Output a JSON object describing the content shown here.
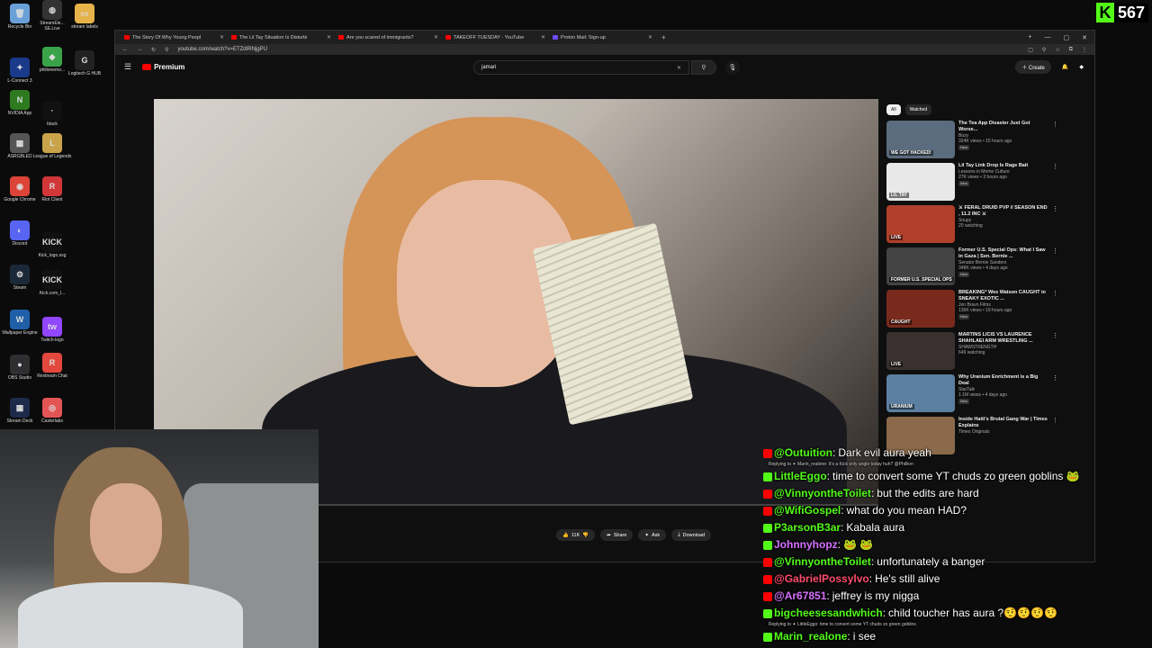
{
  "counter": {
    "value": "567"
  },
  "desktop_icons": [
    {
      "label": "Recycle Bin",
      "color": "#6aa0d8",
      "glyph": "🗑"
    },
    {
      "label": "StreamEle... SE.Live",
      "color": "#333",
      "glyph": "◍"
    },
    {
      "label": "stream labels",
      "color": "#e6b24a",
      "glyph": "▭"
    },
    {
      "label": "L-Connect 3",
      "color": "#1a3a8a",
      "glyph": "✦"
    },
    {
      "label": "philionemo...",
      "color": "#3aa34a",
      "glyph": "◆"
    },
    {
      "label": "Logitech G HUB",
      "color": "#222",
      "glyph": "G"
    },
    {
      "label": "NVIDIA App",
      "color": "#2d7a1f",
      "glyph": "N"
    },
    {
      "label": "black",
      "color": "#111",
      "glyph": "·"
    },
    {
      "label": "ASRGBLED",
      "color": "#555",
      "glyph": "▦"
    },
    {
      "label": "League of Legends",
      "color": "#c9a34a",
      "glyph": "L"
    },
    {
      "label": "Google Chrome",
      "color": "#db4437",
      "glyph": "◉"
    },
    {
      "label": "Riot Client",
      "color": "#d13639",
      "glyph": "R"
    },
    {
      "label": "Discord",
      "color": "#5865f2",
      "glyph": "◐"
    },
    {
      "label": "Kick_logo.svg",
      "color": "#111",
      "glyph": "KICK"
    },
    {
      "label": "Steam",
      "color": "#1b2838",
      "glyph": "⚙"
    },
    {
      "label": "Kick.com_l...",
      "color": "#111",
      "glyph": "KICK"
    },
    {
      "label": "Wallpaper Engine",
      "color": "#1f5fa8",
      "glyph": "W"
    },
    {
      "label": "Twitch-logo",
      "color": "#9146ff",
      "glyph": "tw"
    },
    {
      "label": "OBS Studio",
      "color": "#302e31",
      "glyph": "●"
    },
    {
      "label": "Restream Chat",
      "color": "#e2483d",
      "glyph": "R"
    },
    {
      "label": "Stream Deck",
      "color": "#1e2a4a",
      "glyph": "▦"
    },
    {
      "label": "Casterlabs",
      "color": "#e35555",
      "glyph": "◎"
    }
  ],
  "browser": {
    "tabs": [
      {
        "title": "The Story Of Why Young Peopl",
        "fav": "#ff0000"
      },
      {
        "title": "The Lil Tay Situation Is Disturbi",
        "fav": "#ff0000"
      },
      {
        "title": "Are you scared of immigrants?",
        "fav": "#ff0000"
      },
      {
        "title": "TAKEOFF TUESDAY - YouTube",
        "fav": "#ff0000"
      },
      {
        "title": "Proton Mail: Sign-up",
        "fav": "#6d4aff"
      }
    ],
    "url": "youtube.com/watch?v=ETZdIRNjgPU"
  },
  "youtube": {
    "logo": "Premium",
    "search_value": "jamari",
    "create_label": "Create",
    "actions": {
      "like": "11K",
      "share": "Share",
      "ask": "Ask",
      "download": "Download"
    },
    "chips": [
      "All",
      "Watched"
    ],
    "recommendations": [
      {
        "title": "The Tea App Disaster Just Got Worse...",
        "channel": "Bozy",
        "meta": "324K views • 15 hours ago",
        "badge": "New",
        "thumb": "#5a6c7d",
        "thumb_text": "WE GOT HACKED!"
      },
      {
        "title": "Lil Tay Link Drop Is Rage Bait",
        "channel": "Lessons in Meme Culture",
        "meta": "27K views • 3 hours ago",
        "badge": "New",
        "thumb": "#e8e8e8",
        "thumb_text": "LIL TAY"
      },
      {
        "title": "⚔ FERAL DRUID PVP // SEASON END , 11.2 INC ⚔",
        "channel": "Snupy",
        "meta": "20 watching",
        "badge": "",
        "thumb": "#b0402a",
        "thumb_text": "LIVE"
      },
      {
        "title": "Former U.S. Special Ops: What I Saw in Gaza | Sen. Bernie ...",
        "channel": "Senator Bernie Sanders",
        "meta": "348K views • 4 days ago",
        "badge": "New",
        "thumb": "#444",
        "thumb_text": "FORMER U.S. SPECIAL OPS"
      },
      {
        "title": "BREAKING* Wes Watson CAUGHT in SNEAKY EXOTIC ...",
        "channel": "Jon Bravo Films",
        "meta": "136K views • 19 hours ago",
        "badge": "New",
        "thumb": "#7a2a1c",
        "thumb_text": "CAUGHT"
      },
      {
        "title": "MARTINS LICIS VS LAURENCE SHAHLAEI ARM WRESTLING ...",
        "channel": "SHAWSTRENGTH",
        "meta": "649 watching",
        "badge": "",
        "thumb": "#3a3030",
        "thumb_text": "LIVE"
      },
      {
        "title": "Why Uranium Enrichment is a Big Deal",
        "channel": "StarTalk",
        "meta": "1.1M views • 4 days ago",
        "badge": "New",
        "thumb": "#5b7fa0",
        "thumb_text": "URANIUM"
      },
      {
        "title": "Inside Haiti's Brutal Gang War | Times Explains",
        "channel": "Times Originals",
        "meta": "",
        "badge": "",
        "thumb": "#8a6a4a",
        "thumb_text": ""
      }
    ]
  },
  "chat": [
    {
      "type": "msg",
      "user": "@Outuition",
      "platform": "yt",
      "color": "#53fc18",
      "text": "Dark evil aura yeah"
    },
    {
      "type": "reply",
      "text": "Replying to ✦ Marin_realone: It's a Kick only angle today huh? @Phillion"
    },
    {
      "type": "msg",
      "user": "LittleEggo",
      "platform": "kick",
      "color": "#53fc18",
      "text": "time to convert some YT chuds zo green goblins 🐸"
    },
    {
      "type": "msg",
      "user": "@VinnyontheToilet",
      "platform": "yt",
      "color": "#53fc18",
      "text": "but the edits are hard"
    },
    {
      "type": "msg",
      "user": "@WifiGospel",
      "platform": "yt",
      "color": "#53fc18",
      "text": "what do you mean HAD?"
    },
    {
      "type": "msg",
      "user": "P3arsonB3ar",
      "platform": "kick",
      "color": "#53fc18",
      "text": "Kabala aura"
    },
    {
      "type": "msg",
      "user": "Johnnyhopz",
      "platform": "kick",
      "color": "#d670ff",
      "text": "🐸 🐸"
    },
    {
      "type": "msg",
      "user": "@VinnyontheToilet",
      "platform": "yt",
      "color": "#53fc18",
      "text": "unfortunately a banger"
    },
    {
      "type": "msg",
      "user": "@GabrielPossylvo",
      "platform": "yt",
      "color": "#ff4d6d",
      "text": "He's still alive"
    },
    {
      "type": "msg",
      "user": "@Ar67851",
      "platform": "yt",
      "color": "#d670ff",
      "text": "jeffrey is my nigga"
    },
    {
      "type": "msg",
      "user": "bigcheesesandwhich",
      "platform": "kick",
      "color": "#53fc18",
      "text": "child toucher has aura ?🤨🤨🤨🤨"
    },
    {
      "type": "reply",
      "text": "Replying to ✦ LittleEggo: time to convert some YT chuds zo green goblins"
    },
    {
      "type": "msg",
      "user": "Marin_realone",
      "platform": "kick",
      "color": "#53fc18",
      "text": "i see"
    }
  ]
}
